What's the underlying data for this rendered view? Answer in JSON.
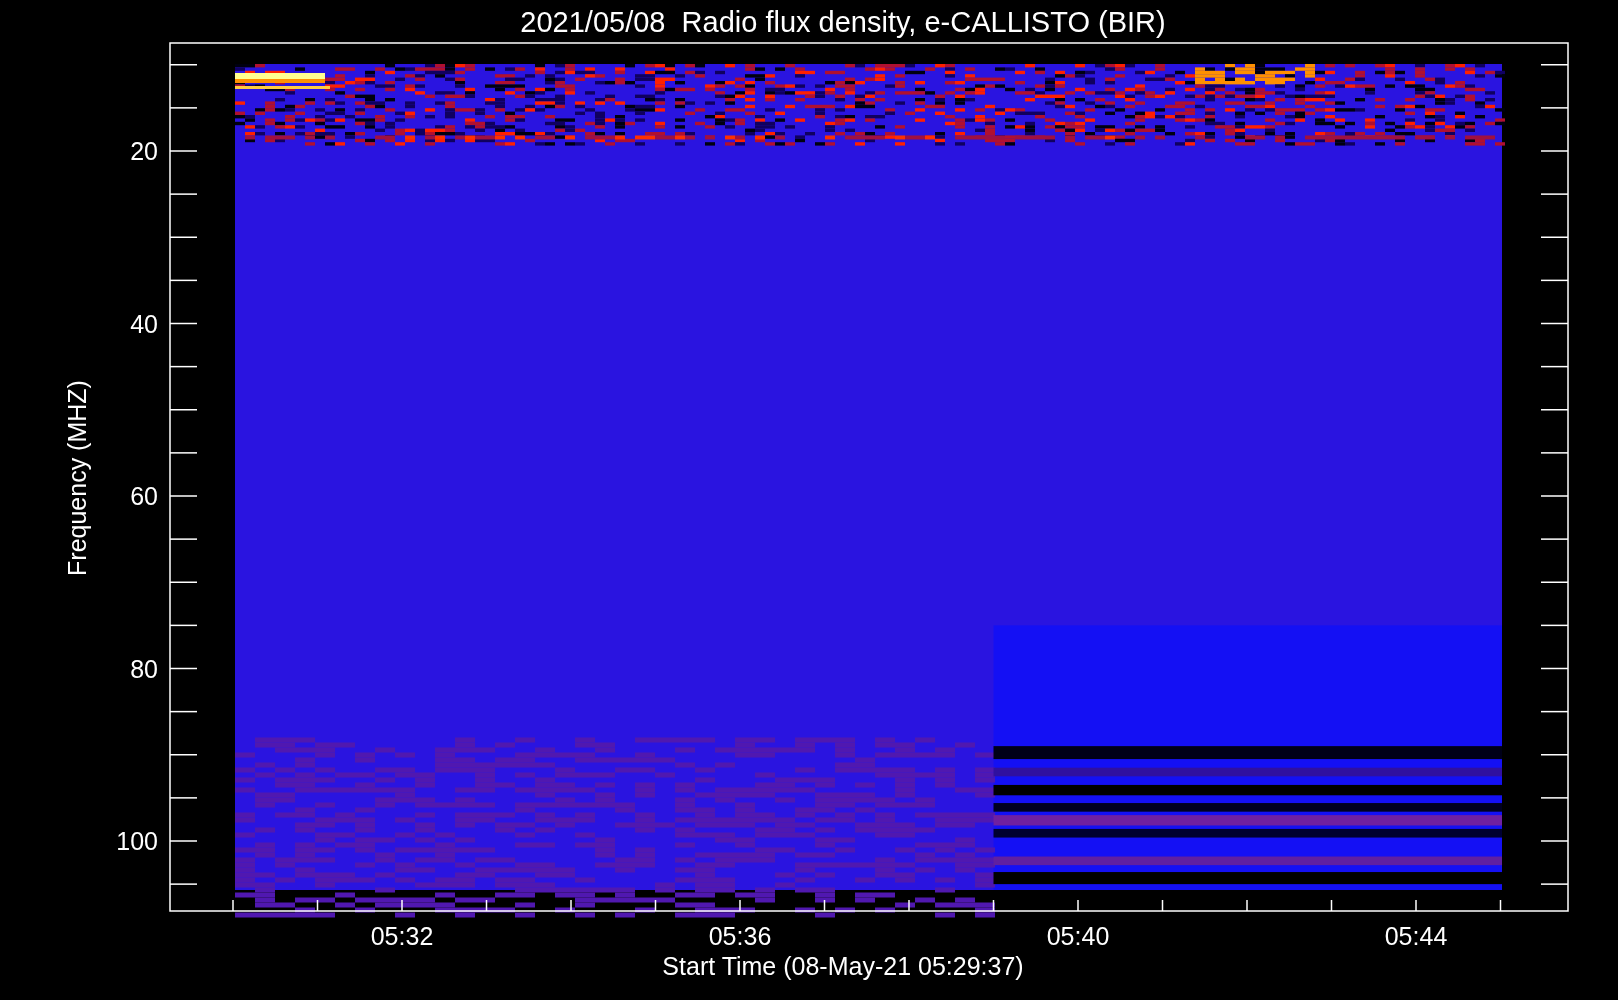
{
  "plot": {
    "title": "2021/05/08  Radio flux density, e-CALLISTO (BIR)",
    "y_axis": {
      "label": "Frequency (MHZ)",
      "ticks": [
        "20",
        "40",
        "60",
        "80",
        "100"
      ]
    },
    "x_axis": {
      "label": "Start Time (08-May-21 05:29:37)",
      "ticks": [
        "05:32",
        "05:36",
        "05:40",
        "05:44"
      ]
    }
  }
}
